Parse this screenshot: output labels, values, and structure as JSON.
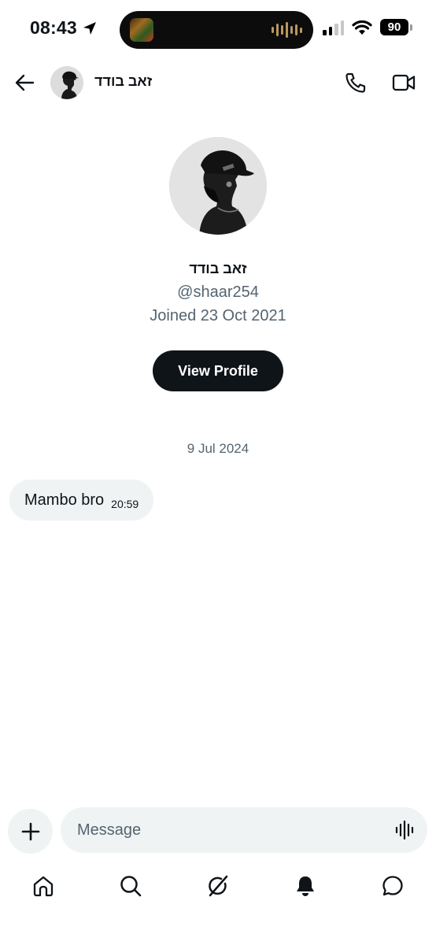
{
  "status_bar": {
    "time": "08:43",
    "battery": "90"
  },
  "header": {
    "contact_name": "זאב בודד"
  },
  "profile": {
    "name": "זאב בודד",
    "handle": "@shaar254",
    "joined": "Joined 23 Oct 2021",
    "view_profile_label": "View Profile"
  },
  "conversation": {
    "date_separator": "9 Jul 2024",
    "messages": [
      {
        "text": "Mambo bro",
        "time": "20:59"
      }
    ]
  },
  "composer": {
    "placeholder": "Message"
  },
  "icons": {
    "back": "back-arrow-icon",
    "call": "phone-icon",
    "video": "video-camera-icon",
    "add": "plus-icon",
    "voice": "voice-wave-icon",
    "nav": [
      "home-icon",
      "search-icon",
      "grok-icon",
      "notifications-bell-icon",
      "messages-icon"
    ]
  },
  "colors": {
    "text_primary": "#0f1419",
    "text_secondary": "#536471",
    "bubble_bg": "#eff3f4",
    "button_bg": "#0f1419"
  }
}
